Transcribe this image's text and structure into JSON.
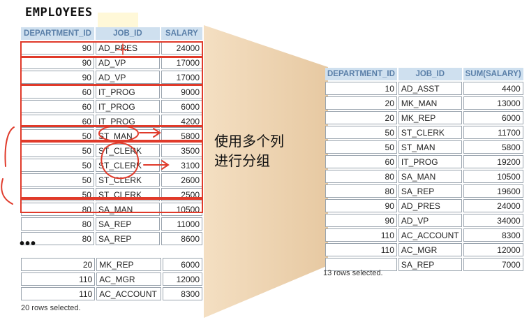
{
  "title": "EMPLOYEES",
  "employees": {
    "headers": [
      "DEPARTMENT_ID",
      "JOB_ID",
      "SALARY"
    ],
    "rows": [
      [
        "90",
        "AD_PRES",
        "24000"
      ],
      [
        "90",
        "AD_VP",
        "17000"
      ],
      [
        "90",
        "AD_VP",
        "17000"
      ],
      [
        "60",
        "IT_PROG",
        "9000"
      ],
      [
        "60",
        "IT_PROG",
        "6000"
      ],
      [
        "60",
        "IT_PROG",
        "4200"
      ],
      [
        "50",
        "ST_MAN",
        "5800"
      ],
      [
        "50",
        "ST_CLERK",
        "3500"
      ],
      [
        "50",
        "ST_CLERK",
        "3100"
      ],
      [
        "50",
        "ST_CLERK",
        "2600"
      ],
      [
        "50",
        "ST_CLERK",
        "2500"
      ],
      [
        "80",
        "SA_MAN",
        "10500"
      ],
      [
        "80",
        "SA_REP",
        "11000"
      ],
      [
        "80",
        "SA_REP",
        "8600"
      ]
    ],
    "ellipsis": "•••",
    "rows_after": [
      [
        "20",
        "MK_REP",
        "6000"
      ],
      [
        "110",
        "AC_MGR",
        "12000"
      ],
      [
        "110",
        "AC_ACCOUNT",
        "8300"
      ]
    ],
    "footer": "20 rows selected."
  },
  "caption": {
    "line1": "使用多个列",
    "line2": "进行分组"
  },
  "result": {
    "headers": [
      "DEPARTMENT_ID",
      "JOB_ID",
      "SUM(SALARY)"
    ],
    "rows": [
      [
        "10",
        "AD_ASST",
        "4400"
      ],
      [
        "20",
        "MK_MAN",
        "13000"
      ],
      [
        "20",
        "MK_REP",
        "6000"
      ],
      [
        "50",
        "ST_CLERK",
        "11700"
      ],
      [
        "50",
        "ST_MAN",
        "5800"
      ],
      [
        "60",
        "IT_PROG",
        "19200"
      ],
      [
        "80",
        "SA_MAN",
        "10500"
      ],
      [
        "80",
        "SA_REP",
        "19600"
      ],
      [
        "90",
        "AD_PRES",
        "24000"
      ],
      [
        "90",
        "AD_VP",
        "34000"
      ],
      [
        "110",
        "AC_ACCOUNT",
        "8300"
      ],
      [
        "110",
        "AC_MGR",
        "12000"
      ],
      [
        "",
        "SA_REP",
        "7000"
      ]
    ],
    "footer": "13 rows selected."
  },
  "colors": {
    "header_bg": "#cfe0ef",
    "header_text": "#5a7fa8",
    "funnel": "#f2dcbf",
    "annotation": "#e03a2a"
  }
}
